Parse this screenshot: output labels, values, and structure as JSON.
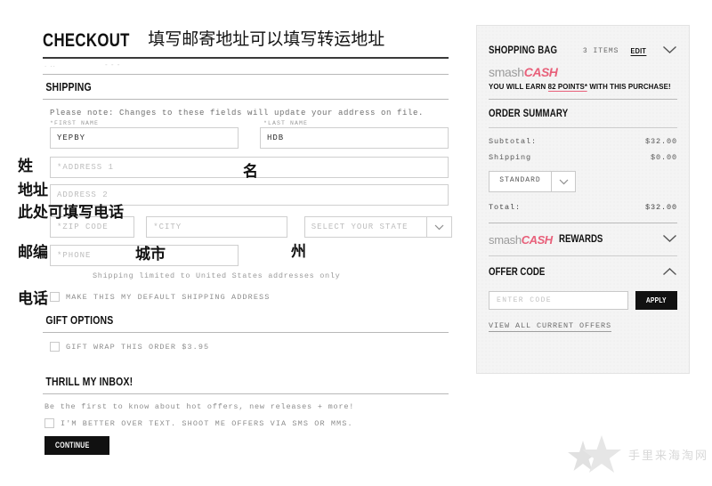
{
  "page": {
    "checkout_title": "CHECKOUT",
    "cn_headline": "填写邮寄地址可以填写转运地址"
  },
  "shipping": {
    "section_title": "SHIPPING",
    "note": "Please note: Changes to these fields will update your address on file.",
    "first_name": {
      "label": "*FIRST NAME",
      "value": "YEPBY"
    },
    "last_name": {
      "label": "*LAST NAME",
      "value": "HDB"
    },
    "address1": {
      "placeholder": "*ADDRESS 1",
      "value": ""
    },
    "address2": {
      "placeholder": "ADDRESS 2",
      "value": ""
    },
    "zip": {
      "placeholder": "*ZIP CODE",
      "value": ""
    },
    "city": {
      "placeholder": "*CITY",
      "value": ""
    },
    "state": {
      "placeholder": "SELECT YOUR STATE",
      "value": ""
    },
    "phone": {
      "placeholder": "*PHONE",
      "value": ""
    },
    "limit_note": "Shipping limited to United States addresses only",
    "default_address_label": "MAKE THIS MY DEFAULT SHIPPING ADDRESS"
  },
  "gift": {
    "section_title": "GIFT OPTIONS",
    "gift_wrap_label": "GIFT WRAP THIS ORDER $3.95"
  },
  "inbox": {
    "section_title": "THRILL MY INBOX!",
    "blurb": "Be the first to know about hot offers, new releases + more!",
    "sms_label": "I'M BETTER OVER TEXT. SHOOT ME OFFERS VIA SMS OR MMS.",
    "continue_label": "CONTINUE"
  },
  "annotations": {
    "last_name_cn": "姓",
    "first_name_cn": "名",
    "address_cn": "地址",
    "address2_cn": "此处可填写电话",
    "zip_cn": "邮编",
    "city_cn": "城市",
    "state_cn": "州",
    "phone_cn": "电话"
  },
  "sidebar": {
    "bag": {
      "title": "SHOPPING BAG",
      "items_count": "3 ITEMS",
      "edit_label": "EDIT"
    },
    "smashcash": {
      "brand_a": "smash",
      "brand_b": "CASH",
      "earn_prefix": "YOU WILL EARN ",
      "earn_points": "82 POINTS*",
      "earn_suffix": " WITH THIS PURCHASE!"
    },
    "order_summary": {
      "title": "ORDER SUMMARY",
      "rows": [
        {
          "label": "Subtotal:",
          "value": "$32.00"
        },
        {
          "label": "Shipping",
          "value": "$0.00"
        }
      ],
      "shipping_method": "STANDARD",
      "total": {
        "label": "Total:",
        "value": "$32.00"
      }
    },
    "rewards": {
      "brand_a": "smash",
      "brand_b": "CASH",
      "title": "REWARDS"
    },
    "offer": {
      "title": "OFFER CODE",
      "input_placeholder": "ENTER CODE",
      "apply_label": "APPLY",
      "view_all_label": "VIEW ALL CURRENT OFFERS"
    }
  },
  "watermark": {
    "text": "手里来海淘网"
  },
  "colors": {
    "accent_pink": "#e8607a",
    "ink": "#111111",
    "panel": "#f4f4f4"
  }
}
